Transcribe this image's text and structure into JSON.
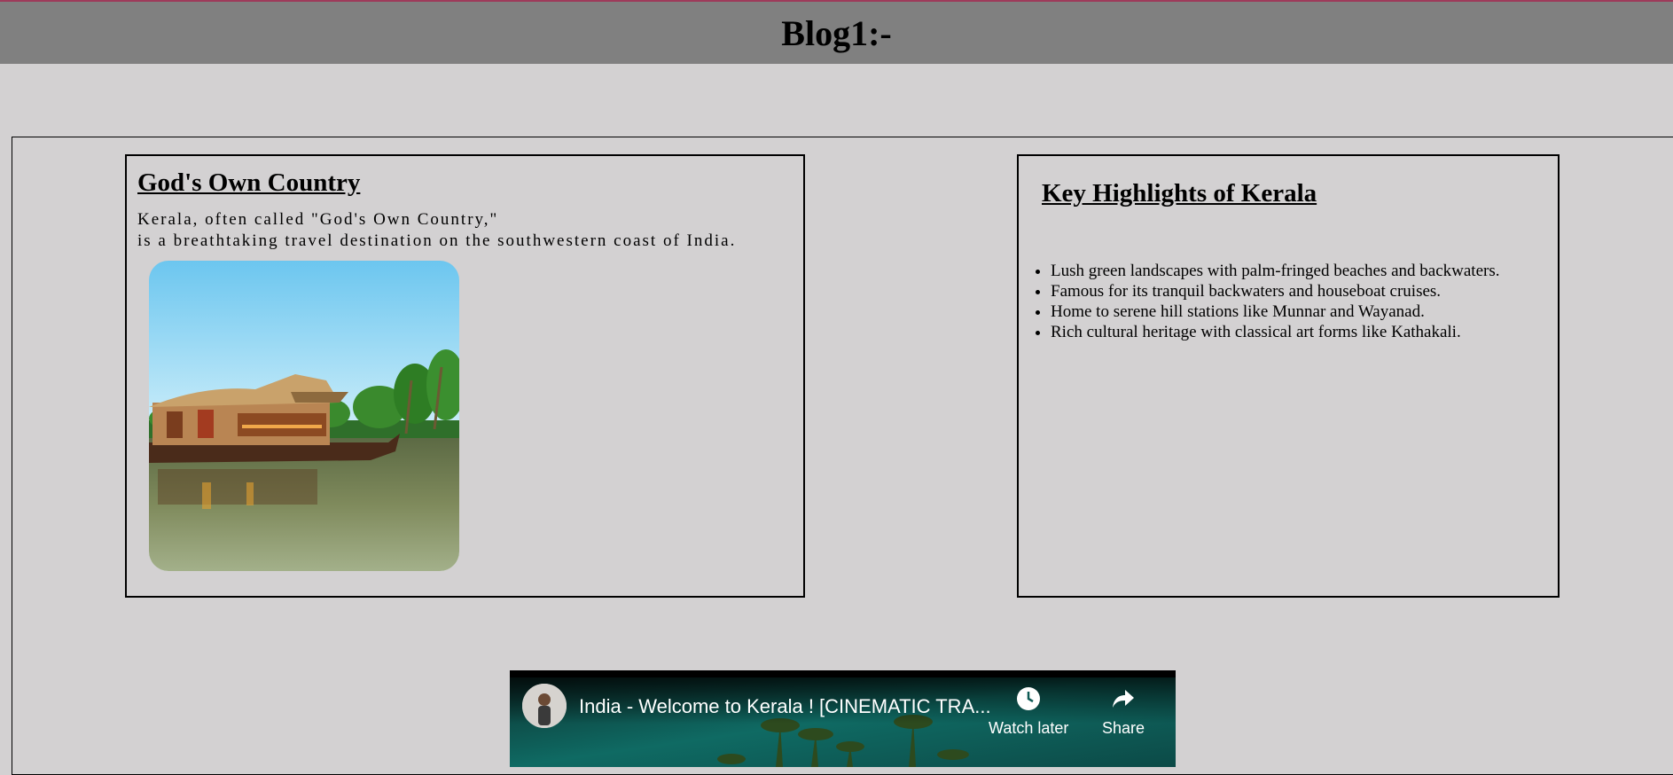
{
  "header": {
    "title": "Blog1:-"
  },
  "left_card": {
    "title": "God's Own Country",
    "desc_line1": "Kerala, often called \"God's Own Country,\"",
    "desc_line2": "is a breathtaking travel destination on the southwestern coast of India.",
    "image_icon": "houseboat-photo"
  },
  "right_card": {
    "title": "Key Highlights of Kerala",
    "items": [
      "Lush green landscapes with palm-fringed beaches and backwaters.",
      "Famous for its tranquil backwaters and houseboat cruises.",
      "Home to serene hill stations like Munnar and Wayanad.",
      "Rich cultural heritage with classical art forms like Kathakali."
    ]
  },
  "video": {
    "title": "India - Welcome to Kerala ! [CINEMATIC TRA...",
    "watch_later_label": "Watch later",
    "share_label": "Share",
    "watch_later_icon": "clock-icon",
    "share_icon": "share-arrow-icon"
  },
  "colors": {
    "page_bg": "#d3d1d2",
    "header_bg": "#808080",
    "header_top_border": "#9e3a5a"
  }
}
